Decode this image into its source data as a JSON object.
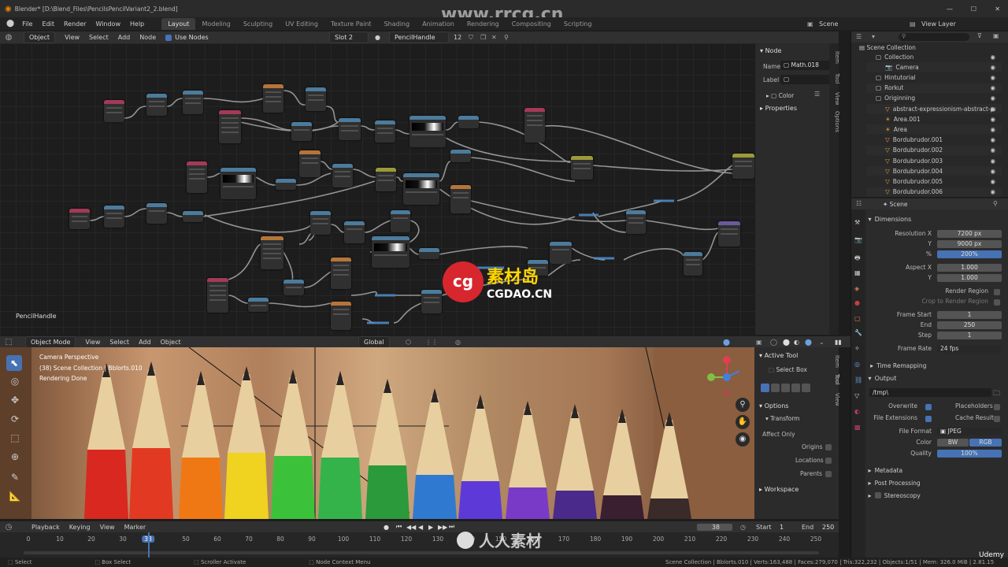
{
  "window_title": "Blender* [D:\\Blend_Files\\PencilsPencilVariant2_2.blend]",
  "top_menu": [
    "File",
    "Edit",
    "Render",
    "Window",
    "Help"
  ],
  "workspace_tabs": [
    "Layout",
    "Modeling",
    "Sculpting",
    "UV Editing",
    "Texture Paint",
    "Shading",
    "Animation",
    "Rendering",
    "Compositing",
    "Scripting"
  ],
  "scene_label": "Scene",
  "view_layer_label": "View Layer",
  "node_header": {
    "object_dd": "Object",
    "menus": [
      "View",
      "Select",
      "Add",
      "Node"
    ],
    "use_nodes": "Use Nodes",
    "slot": "Slot 2",
    "material": "PencilHandle",
    "users": "12"
  },
  "node_sidebar": {
    "section": "Node",
    "name_label": "Name",
    "name_value": "Math.018",
    "label_label": "Label",
    "color_label": "Color",
    "properties_label": "Properties",
    "tabs": [
      "Item",
      "Tool",
      "View",
      "Options"
    ]
  },
  "node_editor_label": "PencilHandle",
  "viewport_header": {
    "mode": "Object Mode",
    "menus": [
      "View",
      "Select",
      "Add",
      "Object"
    ],
    "orientation": "Global"
  },
  "viewport_overlay": {
    "line1": "Camera Perspective",
    "line2": "(38) Scene Collection | Bblorts.010",
    "line3": "Rendering Done"
  },
  "viewport_sidebar": {
    "active_tool": "Active Tool",
    "select_box": "Select Box",
    "options": "Options",
    "transform": "Transform",
    "affect_only": "Affect Only",
    "origins": "Origins",
    "locations": "Locations",
    "parents": "Parents",
    "workspace": "Workspace",
    "tabs": [
      "Item",
      "Tool",
      "View"
    ]
  },
  "outliner": {
    "title": "Scene Collection",
    "items": [
      {
        "label": "Collection",
        "indent": 1
      },
      {
        "label": "Camera",
        "indent": 2
      },
      {
        "label": "Hintutorial",
        "indent": 1
      },
      {
        "label": "Rorkut",
        "indent": 1
      },
      {
        "label": "Originning",
        "indent": 1
      },
      {
        "label": "abstract-expressionism-abstract-paint",
        "indent": 2
      },
      {
        "label": "Area.001",
        "indent": 2
      },
      {
        "label": "Area",
        "indent": 2
      },
      {
        "label": "Bordubrudor.001",
        "indent": 2
      },
      {
        "label": "Bordubrudor.002",
        "indent": 2
      },
      {
        "label": "Bordubrudor.003",
        "indent": 2
      },
      {
        "label": "Bordubrudor.004",
        "indent": 2
      },
      {
        "label": "Bordubrudor.005",
        "indent": 2
      },
      {
        "label": "Bordubrudor.006",
        "indent": 2
      }
    ]
  },
  "properties": {
    "context": "Scene",
    "dimensions": "Dimensions",
    "resolution_x_label": "Resolution X",
    "resolution_x": "7200 px",
    "y_label": "Y",
    "resolution_y": "9000 px",
    "pct_label": "%",
    "percent": "200%",
    "aspect_x_label": "Aspect X",
    "aspect_x": "1.000",
    "aspect_y": "1.000",
    "render_region": "Render Region",
    "crop_region": "Crop to Render Region",
    "frame_start_label": "Frame Start",
    "frame_start": "1",
    "end_label": "End",
    "frame_end": "250",
    "step_label": "Step",
    "frame_step": "1",
    "frame_rate_label": "Frame Rate",
    "frame_rate": "24 fps",
    "time_remapping": "Time Remapping",
    "output": "Output",
    "output_path": "/tmp\\",
    "overwrite": "Overwrite",
    "placeholders": "Placeholders",
    "file_extensions": "File Extensions",
    "cache_result": "Cache Result",
    "file_format_label": "File Format",
    "file_format": "JPEG",
    "color_label": "Color",
    "color_bw": "BW",
    "color_rgb": "RGB",
    "quality_label": "Quality",
    "quality": "100%",
    "metadata": "Metadata",
    "post_processing": "Post Processing",
    "stereoscopy": "Stereoscopy"
  },
  "timeline": {
    "menus": [
      "Playback",
      "Keying",
      "View",
      "Marker"
    ],
    "current_frame": "38",
    "start_label": "Start",
    "start": "1",
    "end_label": "End",
    "end": "250",
    "ticks": [
      "0",
      "10",
      "20",
      "30",
      "38",
      "50",
      "60",
      "70",
      "80",
      "90",
      "100",
      "110",
      "120",
      "130",
      "140",
      "150",
      "160",
      "170",
      "180",
      "190",
      "200",
      "210",
      "220",
      "230",
      "240",
      "250"
    ]
  },
  "status_bar": {
    "select": "Select",
    "box_select": "Box Select",
    "scroller": "Scroller Activate",
    "context_menu": "Node Context Menu",
    "stats": "Scene Collection | Bblorts.010 | Verts:163,488 | Faces:279,070 | Tris:322,232 | Objects:1/51 | Mem: 326.0 MiB | 2.81.15"
  },
  "watermarks": {
    "top": "www.rrcg.cn",
    "center_cn": "素材岛",
    "center_en": "CGDAO.CN",
    "bottom_cn": "人人素材",
    "udemy": "Udemy"
  },
  "colors": {
    "accent": "#4772b3",
    "node_pink": "#a33a57",
    "node_blue": "#4c7b9b",
    "node_orange": "#b5753a",
    "node_yellow": "#9a9a3a",
    "node_purple": "#6b5a9a"
  }
}
